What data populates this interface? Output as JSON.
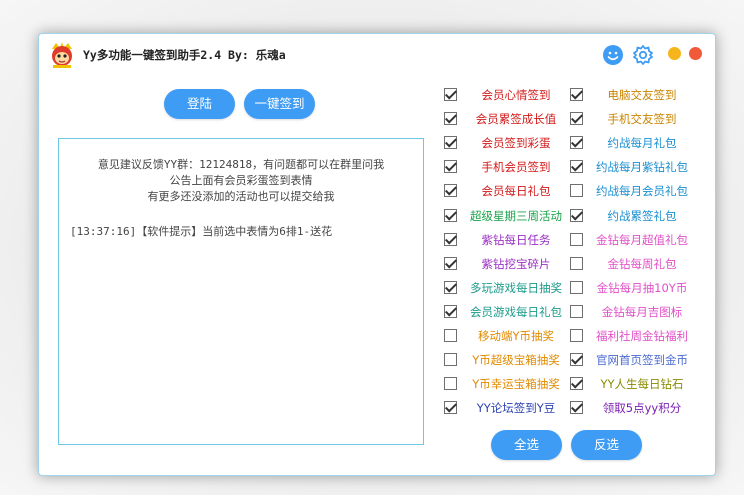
{
  "window": {
    "title": "Yy多功能一键签到助手2.4 By: 乐魂a"
  },
  "toolbar": {
    "login_label": "登陆",
    "signin_all_label": "一键签到"
  },
  "log": {
    "notice_lines": [
      "意见建议反馈YY群：12124818，有问题都可以在群里问我",
      "公告上面有会员彩蛋签到表情",
      "有更多还没添加的活动也可以提交给我"
    ],
    "entries": [
      "[13:37:16]【软件提示】当前选中表情为6排1-送花"
    ]
  },
  "options_left": [
    {
      "label": "会员心情签到",
      "checked": true,
      "color": "#d21a1a"
    },
    {
      "label": "会员累签成长值",
      "checked": true,
      "color": "#d21a1a"
    },
    {
      "label": "会员签到彩蛋",
      "checked": true,
      "color": "#d21a1a"
    },
    {
      "label": "手机会员签到",
      "checked": true,
      "color": "#d21a1a"
    },
    {
      "label": "会员每日礼包",
      "checked": true,
      "color": "#d21a1a"
    },
    {
      "label": "超级星期三周活动",
      "checked": true,
      "color": "#1aa34a"
    },
    {
      "label": "紫钻每日任务",
      "checked": true,
      "color": "#9b2fc4"
    },
    {
      "label": "紫钻挖宝碎片",
      "checked": true,
      "color": "#9b2fc4"
    },
    {
      "label": "多玩游戏每日抽奖",
      "checked": true,
      "color": "#1a9a8a"
    },
    {
      "label": "会员游戏每日礼包",
      "checked": true,
      "color": "#1a9a8a"
    },
    {
      "label": "移动端Y币抽奖",
      "checked": false,
      "color": "#e08a00"
    },
    {
      "label": "Y币超级宝箱抽奖",
      "checked": false,
      "color": "#e08a00"
    },
    {
      "label": "Y币幸运宝箱抽奖",
      "checked": false,
      "color": "#e08a00"
    },
    {
      "label": "YY论坛签到Y豆",
      "checked": true,
      "color": "#2a3fb0"
    }
  ],
  "options_right": [
    {
      "label": "电脑交友签到",
      "checked": true,
      "color": "#c88400"
    },
    {
      "label": "手机交友签到",
      "checked": true,
      "color": "#c88400"
    },
    {
      "label": "约战每月礼包",
      "checked": true,
      "color": "#1a8fd0"
    },
    {
      "label": "约战每月紫钻礼包",
      "checked": true,
      "color": "#1a8fd0"
    },
    {
      "label": "约战每月会员礼包",
      "checked": false,
      "color": "#1a8fd0"
    },
    {
      "label": "约战累签礼包",
      "checked": true,
      "color": "#1a8fd0"
    },
    {
      "label": "金钻每月超值礼包",
      "checked": false,
      "color": "#e04fc7"
    },
    {
      "label": "金钻每周礼包",
      "checked": false,
      "color": "#e04fc7"
    },
    {
      "label": "金钻每月抽10Y币",
      "checked": false,
      "color": "#e04fc7"
    },
    {
      "label": "金钻每月吉图标",
      "checked": false,
      "color": "#e04fc7"
    },
    {
      "label": "福利社周金钻福利",
      "checked": false,
      "color": "#e04fc7"
    },
    {
      "label": "官网首页签到金币",
      "checked": true,
      "color": "#4a6ad0"
    },
    {
      "label": "YY人生每日钻石",
      "checked": true,
      "color": "#8a8a00"
    },
    {
      "label": "领取5点yy积分",
      "checked": true,
      "color": "#7a1fb0"
    }
  ],
  "bottom": {
    "select_all_label": "全选",
    "invert_label": "反选"
  },
  "icons": {
    "logo": "monkey-logo-icon",
    "face": "smiley-icon",
    "settings": "gear-icon",
    "minimize": "minimize-dot",
    "close": "close-dot"
  },
  "colors": {
    "accent_blue": "#3f9cf5",
    "minimize_yellow": "#f7b51c",
    "close_red": "#f05a3a",
    "border_cyan": "#6fc6e6"
  }
}
